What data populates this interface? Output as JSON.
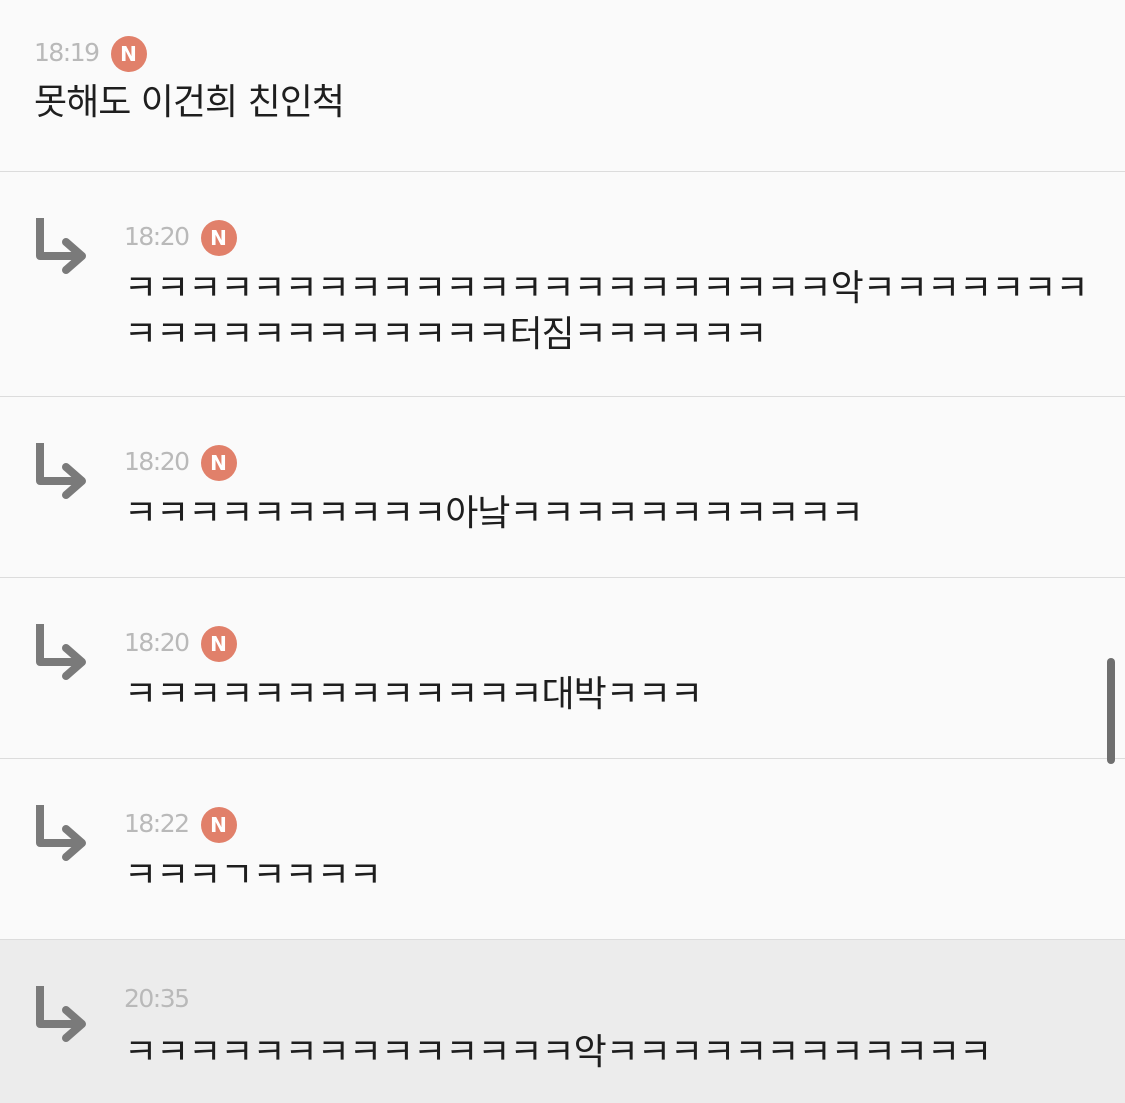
{
  "root_post": {
    "time": "18:19",
    "badge": "N",
    "text": "못해도 이건희 친인척"
  },
  "replies": [
    {
      "time": "18:20",
      "badge": "N",
      "text": "ㅋㅋㅋㅋㅋㅋㅋㅋㅋㅋㅋㅋㅋㅋㅋㅋㅋㅋㅋㅋㅋㅋ악ㅋㅋㅋㅋㅋㅋㅋㅋㅋㅋㅋㅋㅋㅋㅋㅋㅋㅋㅋ터짐ㅋㅋㅋㅋㅋㅋ"
    },
    {
      "time": "18:20",
      "badge": "N",
      "text": "ㅋㅋㅋㅋㅋㅋㅋㅋㅋㅋ아낰ㅋㅋㅋㅋㅋㅋㅋㅋㅋㅋㅋ"
    },
    {
      "time": "18:20",
      "badge": "N",
      "text": "ㅋㅋㅋㅋㅋㅋㅋㅋㅋㅋㅋㅋㅋ대박ㅋㅋㅋ"
    },
    {
      "time": "18:22",
      "badge": "N",
      "text": "ㅋㅋㅋㄱㅋㅋㅋㅋ"
    },
    {
      "time": "20:35",
      "badge": "",
      "text": "ㅋㅋㅋㅋㅋㅋㅋㅋㅋㅋㅋㅋㅋㅋ악ㅋㅋㅋㅋㅋㅋㅋㅋㅋㅋㅋㅋ"
    }
  ],
  "colors": {
    "badge": "#e1806a",
    "timestamp": "#b9b9b9",
    "reply_arrow": "#7a7a7a",
    "highlight_row": "#ececec"
  },
  "icons": {
    "reply": "reply-arrow-icon"
  }
}
